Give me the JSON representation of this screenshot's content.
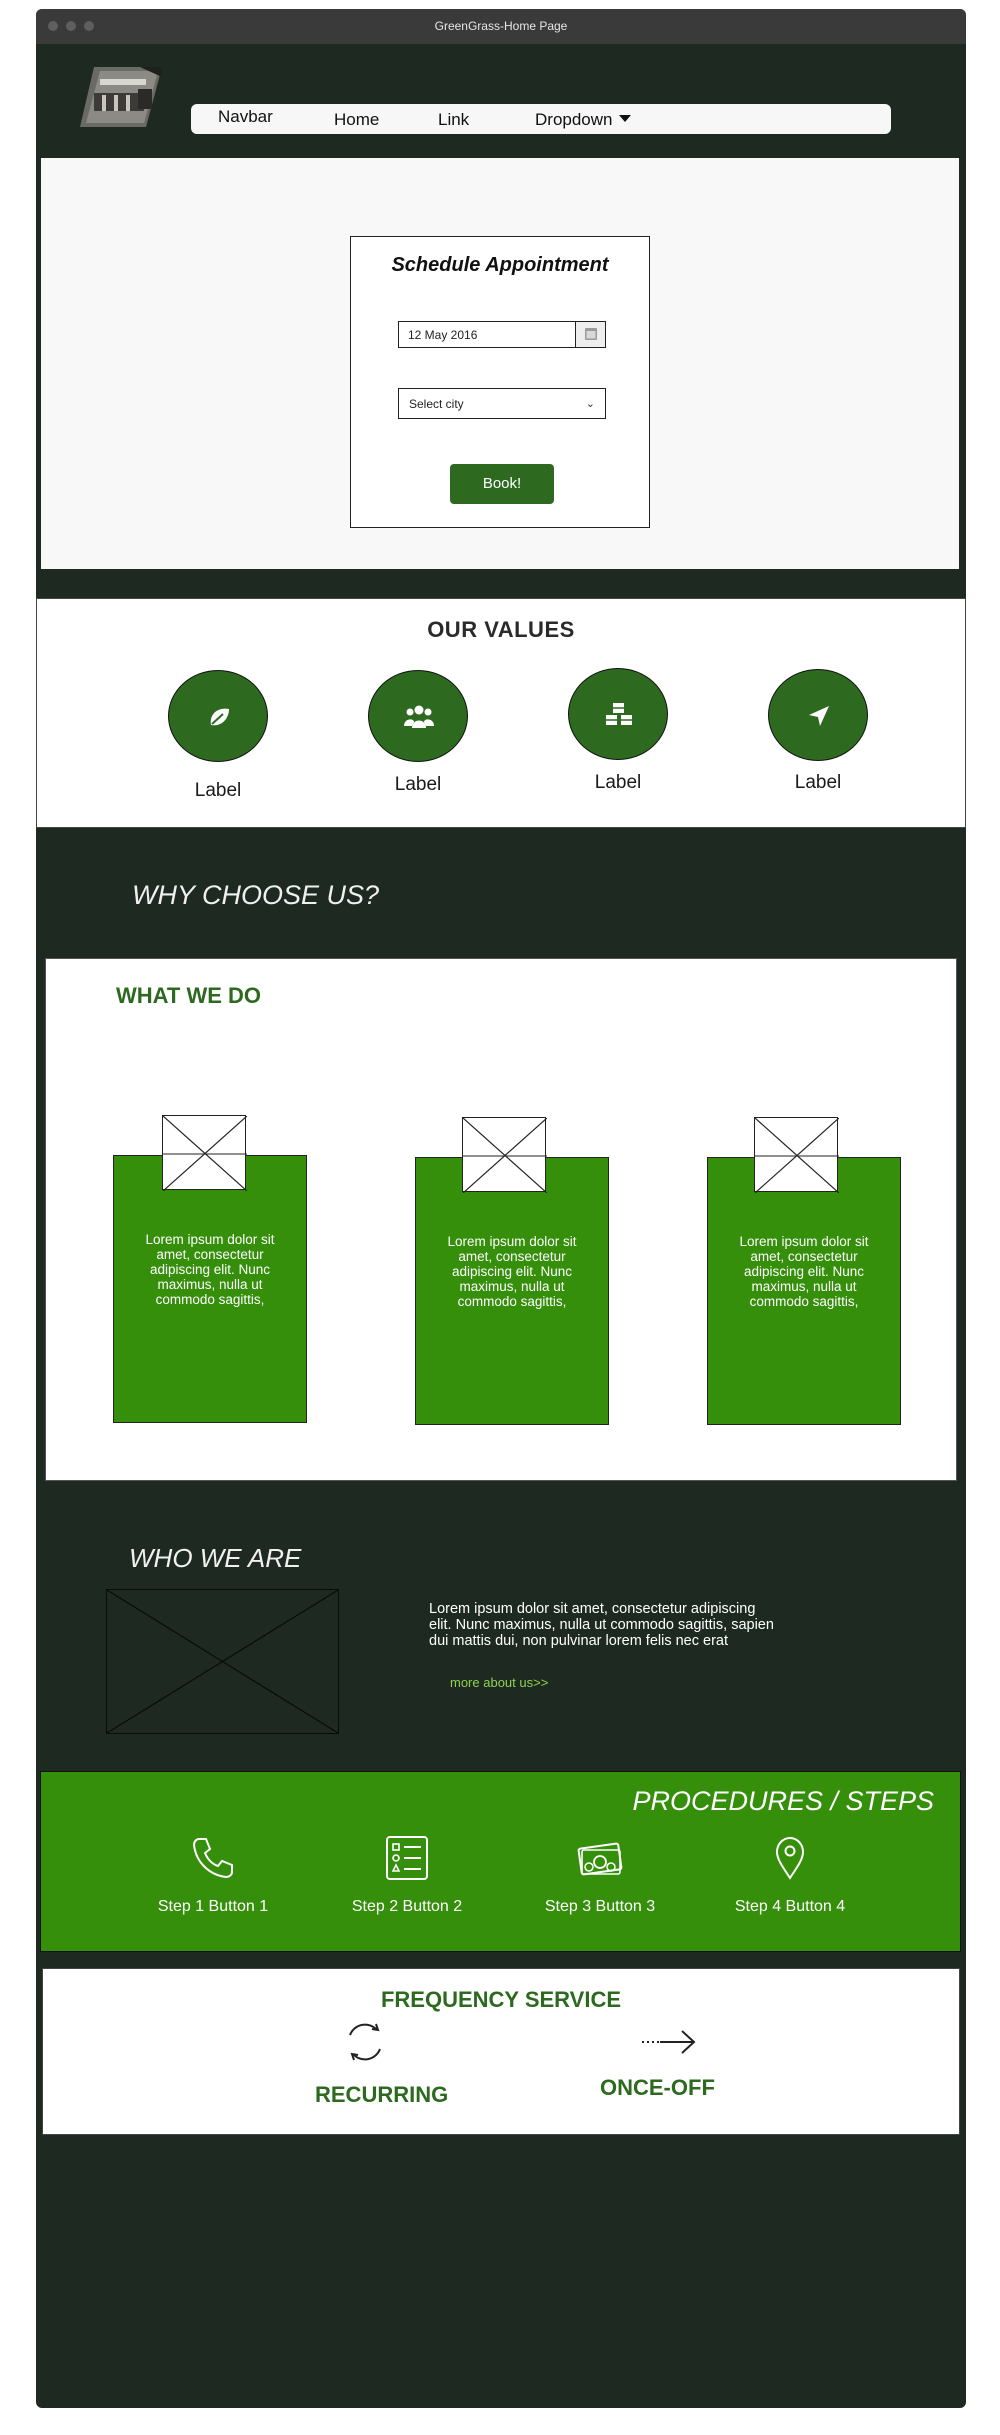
{
  "window": {
    "title": "GreenGrass-Home Page"
  },
  "nav": {
    "brand": "Navbar",
    "links": [
      "Home",
      "Link",
      "Dropdown"
    ]
  },
  "appointment": {
    "title": "Schedule Appointment",
    "date_value": "12 May 2016",
    "city_placeholder": "Select city",
    "book_label": "Book!"
  },
  "values": {
    "title": "OUR VALUES",
    "items": [
      {
        "label": "Label",
        "icon": "leaf-icon"
      },
      {
        "label": "Label",
        "icon": "users-icon"
      },
      {
        "label": "Label",
        "icon": "cubes-icon"
      },
      {
        "label": "Label",
        "icon": "location-arrow-icon"
      }
    ]
  },
  "why": {
    "title": "WHY CHOOSE US?"
  },
  "what_we_do": {
    "title": "WHAT WE DO",
    "cards": [
      {
        "text": "Lorem ipsum dolor sit amet, consectetur adipiscing elit. Nunc maximus, nulla ut commodo sagittis,"
      },
      {
        "text": "Lorem ipsum dolor sit amet, consectetur adipiscing elit. Nunc maximus, nulla ut commodo sagittis,"
      },
      {
        "text": "Lorem ipsum dolor sit amet, consectetur adipiscing elit. Nunc maximus, nulla ut commodo sagittis,"
      }
    ]
  },
  "who": {
    "title": "WHO WE ARE",
    "text": "Lorem ipsum dolor sit amet, consectetur adipiscing elit. Nunc maximus, nulla ut commodo sagittis, sapien dui mattis dui, non pulvinar lorem felis nec erat",
    "more_link": "more about us>>"
  },
  "procedures": {
    "title": "PROCEDURES /  STEPS",
    "steps": [
      {
        "label": "Step 1 Button 1",
        "icon": "phone-icon"
      },
      {
        "label": "Step 2 Button 2",
        "icon": "checklist-icon"
      },
      {
        "label": "Step 3 Button 3",
        "icon": "money-icon"
      },
      {
        "label": "Step 4 Button 4",
        "icon": "map-pin-icon"
      }
    ]
  },
  "frequency": {
    "title": "FREQUENCY SERVICE",
    "options": [
      {
        "label": "RECURRING",
        "icon": "refresh-icon"
      },
      {
        "label": "ONCE-OFF",
        "icon": "arrow-right-icon"
      }
    ]
  },
  "colors": {
    "page_bg": "#1e2a21",
    "brand_green": "#2d6a1f",
    "bright_green": "#358f0b",
    "link_green": "#8fd14f"
  }
}
